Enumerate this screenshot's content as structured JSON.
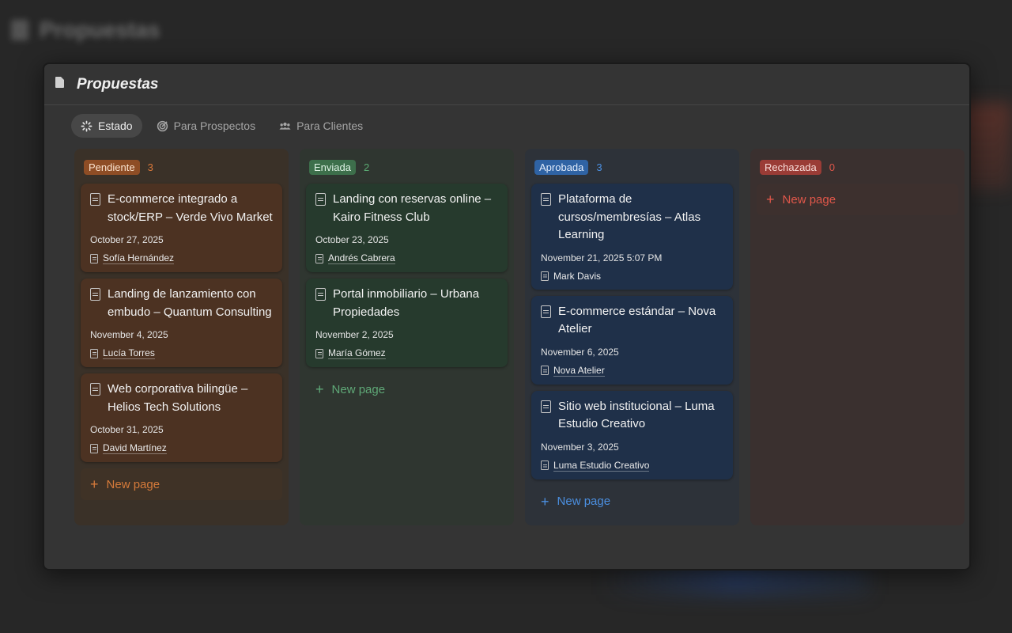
{
  "background": {
    "title": "Propuestas"
  },
  "modal": {
    "title": "Propuestas",
    "tabs": [
      {
        "label": "Estado",
        "icon": "loader-icon",
        "active": true
      },
      {
        "label": "Para Prospectos",
        "icon": "target-icon",
        "active": false
      },
      {
        "label": "Para Clientes",
        "icon": "people-icon",
        "active": false
      }
    ]
  },
  "columns": [
    {
      "name": "Pendiente",
      "count": "3",
      "color": "#d9783a",
      "cards": [
        {
          "title": "E-commerce integrado a stock/ERP – Verde Vivo Market",
          "date": "October 27, 2025",
          "person": "Sofía Hernández"
        },
        {
          "title": "Landing de lanzamiento con embudo – Quantum Consulting",
          "date": "November 4, 2025",
          "person": "Lucía Torres"
        },
        {
          "title": "Web corporativa bilingüe – Helios Tech Solutions",
          "date": "October 31, 2025",
          "person": "David Martínez"
        }
      ],
      "new_page": "New page"
    },
    {
      "name": "Enviada",
      "count": "2",
      "color": "#5bab73",
      "cards": [
        {
          "title": "Landing con reservas online – Kairo Fitness Club",
          "date": "October 23, 2025",
          "person": "Andrés Cabrera"
        },
        {
          "title": "Portal inmobiliario – Urbana Propiedades",
          "date": "November 2, 2025",
          "person": "María Gómez"
        }
      ],
      "new_page": "New page"
    },
    {
      "name": "Aprobada",
      "count": "3",
      "color": "#4b8fe0",
      "cards": [
        {
          "title": "Plataforma de cursos/membresías – Atlas Learning",
          "date": "November 21, 2025 5:07 PM",
          "person": "Mark Davis"
        },
        {
          "title": "E-commerce estándar – Nova Atelier",
          "date": "November 6, 2025",
          "person": "Nova Atelier"
        },
        {
          "title": "Sitio web institucional – Luma Estudio Creativo",
          "date": "November 3, 2025",
          "person": "Luma Estudio Creativo"
        }
      ],
      "new_page": "New page"
    },
    {
      "name": "Rechazada",
      "count": "0",
      "color": "#e0574a",
      "cards": [],
      "new_page": "New page"
    }
  ]
}
